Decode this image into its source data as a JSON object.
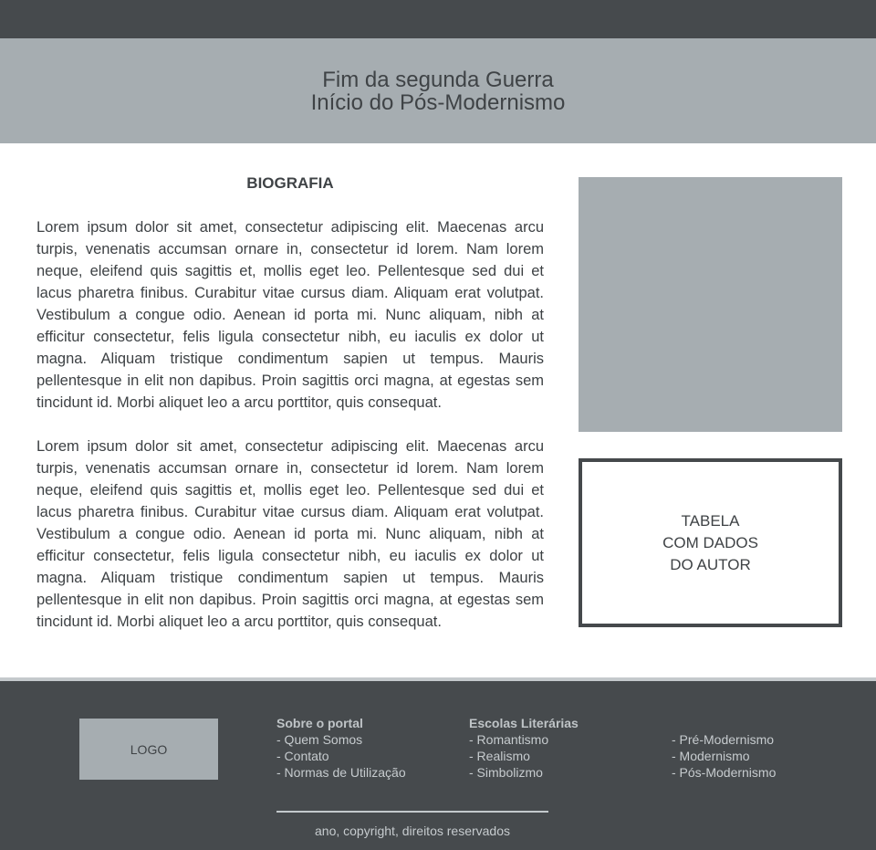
{
  "hero": {
    "line1": "Fim da segunda Guerra",
    "line2": "Início do Pós-Modernismo"
  },
  "biography": {
    "title": "BIOGRAFIA",
    "paragraphs": [
      "Lorem ipsum dolor sit amet, consectetur adipiscing elit. Maecenas arcu turpis, venenatis accumsan ornare in, consectetur id lorem. Nam lorem neque, eleifend quis sagittis et, mollis eget leo. Pellentesque sed dui et lacus pharetra finibus. Curabitur vitae cursus diam. Aliquam erat volutpat. Vestibulum a congue odio. Aenean id porta mi. Nunc aliquam, nibh at efficitur consectetur, felis ligula consectetur nibh, eu iaculis ex dolor ut magna. Aliquam tristique condimentum sapien ut tempus. Mauris pellentesque in elit non dapibus. Proin sagittis orci magna, at egestas sem tincidunt id. Morbi aliquet leo a arcu porttitor, quis consequat.",
      "Lorem ipsum dolor sit amet, consectetur adipiscing elit. Maecenas arcu turpis, venenatis accumsan ornare in, consectetur id lorem. Nam lorem neque, eleifend quis sagittis et, mollis eget leo. Pellentesque sed dui et lacus pharetra finibus. Curabitur vitae cursus diam. Aliquam erat volutpat. Vestibulum a congue odio. Aenean id porta mi. Nunc aliquam, nibh at efficitur consectetur, felis ligula consectetur nibh, eu iaculis ex dolor ut magna. Aliquam tristique condimentum sapien ut tempus. Mauris pellentesque in elit non dapibus. Proin sagittis orci magna, at egestas sem tincidunt id. Morbi aliquet leo a arcu porttitor, quis consequat."
    ]
  },
  "author_table": {
    "lines": [
      "TABELA",
      "COM DADOS",
      "DO AUTOR"
    ]
  },
  "footer": {
    "logo": "LOGO",
    "about": {
      "heading": "Sobre o portal",
      "links": [
        "- Quem Somos",
        "- Contato",
        "- Normas de Utilização"
      ]
    },
    "schools": {
      "heading": "Escolas Literárias",
      "links": [
        "- Romantismo",
        "- Realismo",
        "- Simbolizmo"
      ],
      "links_more": [
        "- Pré-Modernismo",
        "- Modernismo",
        "- Pós-Modernismo"
      ]
    },
    "copyright": "ano, copyright, direitos reservados"
  },
  "colors": {
    "dark": "#464a4d",
    "placeholder_gray": "#a6adb1",
    "text": "#45494c"
  }
}
